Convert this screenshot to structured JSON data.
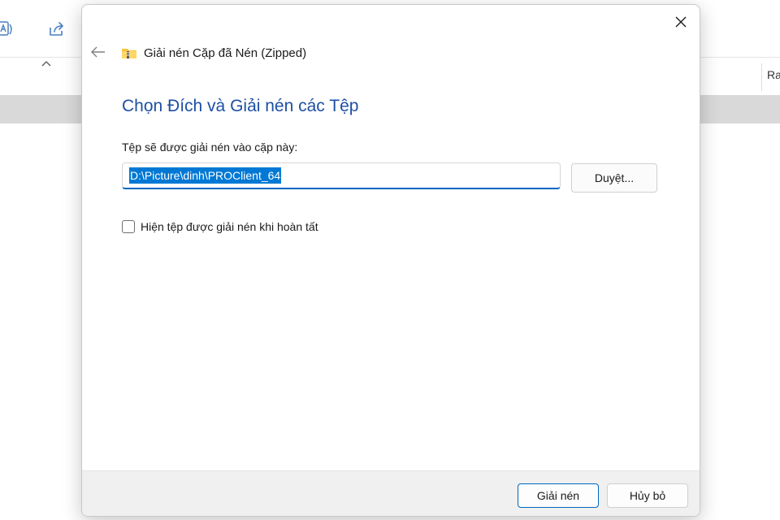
{
  "background": {
    "toolbar_icons": [
      "translate-icon",
      "share-icon"
    ],
    "column_label": "Ra"
  },
  "dialog": {
    "title": "Giải nén Cặp đã Nén (Zipped)",
    "heading": "Chọn Đích và Giải nén các Tệp",
    "field_label": "Tệp sẽ được giải nén vào cặp này:",
    "path_value": "D:\\Picture\\dinh\\PROClient_64",
    "browse_label": "Duyệt...",
    "checkbox_label": "Hiện tệp được giải nén khi hoàn tất",
    "checkbox_checked": false,
    "extract_label": "Giải nén",
    "cancel_label": "Hủy bỏ",
    "icons": [
      "close-icon",
      "back-arrow-icon",
      "zip-folder-icon"
    ]
  },
  "colors": {
    "accent": "#0067c0",
    "heading": "#1e4fa3",
    "selection": "#0078d4",
    "footer_bg": "#f0f0f0",
    "stripe": "#d9d9d9"
  }
}
